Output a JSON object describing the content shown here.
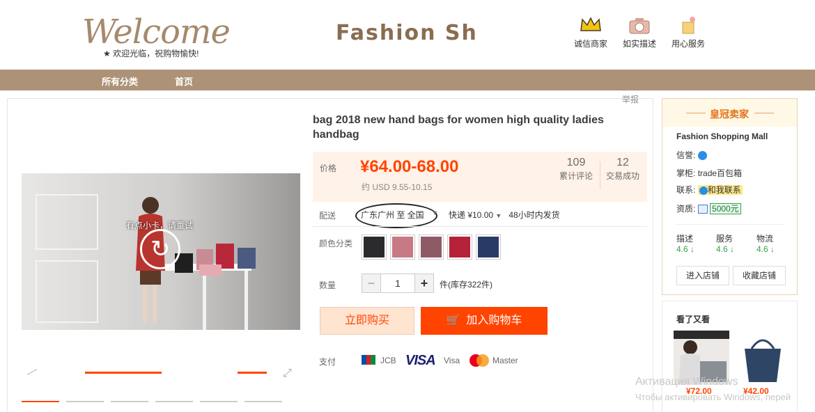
{
  "header": {
    "logo_text": "Welcome",
    "logo_sub": "欢迎光临，祝购物愉快!",
    "shop_name": "Fashion Sh",
    "badges": [
      {
        "label": "诚信商家",
        "icon": "crown-icon"
      },
      {
        "label": "如实描述",
        "icon": "camera-icon"
      },
      {
        "label": "用心服务",
        "icon": "gift-icon"
      }
    ]
  },
  "nav": {
    "items": [
      "所有分类",
      "首页"
    ]
  },
  "report_label": "举报",
  "product": {
    "title": "bag 2018 new hand bags for women high quality ladies handbag",
    "price_label": "价格",
    "price": "¥64.00-68.00",
    "usd": "约 USD 9.55-10.15",
    "reviews_count": "109",
    "reviews_label": "累计评论",
    "sales_count": "12",
    "sales_label": "交易成功",
    "ship_label": "配送",
    "ship_from": "广东广州 至  全国",
    "express": "快递 ¥10.00",
    "ship_time": "48小时内发货",
    "color_label": "颜色分类",
    "colors": [
      "#2b2b2e",
      "#c77a86",
      "#8e5a66",
      "#b5223a",
      "#2a3a66"
    ],
    "qty_label": "数量",
    "qty_value": "1",
    "minus": "−",
    "plus": "+",
    "stock": "件(库存322件)",
    "buy_now": "立即购买",
    "add_cart": "加入购物车",
    "pay_label": "支付",
    "pay_methods": [
      "JCB",
      "VISA",
      "Visa",
      "Master"
    ]
  },
  "video": {
    "overlay_text": "有点小卡，请重试"
  },
  "seller": {
    "header": "皇冠卖家",
    "name": "Fashion Shopping Mall",
    "rep_label": "信誉:",
    "shopkeeper_label": "掌柜:",
    "shopkeeper": "trade百包箱",
    "contact_label": "联系:",
    "contact_btn": "和我联系",
    "qual_label": "资质:",
    "deposit": "5000元",
    "ratings": [
      {
        "label": "描述",
        "value": "4.6 ↓"
      },
      {
        "label": "服务",
        "value": "4.6 ↓"
      },
      {
        "label": "物流",
        "value": "4.6 ↓"
      }
    ],
    "enter_shop": "进入店铺",
    "fav_shop": "收藏店铺"
  },
  "seen": {
    "title": "看了又看",
    "items": [
      {
        "price": "¥72.00"
      },
      {
        "price": "¥42.00"
      }
    ]
  },
  "watermark": {
    "line1": "Активация Windows",
    "line2": "Чтобы активировать Windows, перей"
  }
}
